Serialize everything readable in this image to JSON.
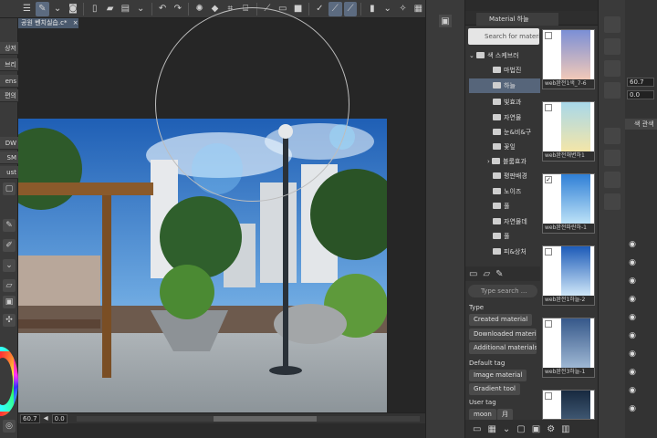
{
  "document": {
    "tab_title": "공원 벤치실습.c*",
    "close_glyph": "×"
  },
  "left_panel": {
    "labels": [
      "상저",
      "브리",
      "ens",
      "편의",
      "DW",
      "SM",
      "ust"
    ],
    "wheel_colors": [
      "#ff3333",
      "#ffff33",
      "#33ff33",
      "#33ffff",
      "#3333ff",
      "#ff33ff"
    ]
  },
  "status": {
    "zoom": "60.7",
    "angle": "0.0"
  },
  "material_panel": {
    "tab_label": "Material 하늘",
    "search_placeholder": "Search for materials",
    "tree": [
      {
        "label": "색 스케브러"
      },
      {
        "label": "마법진"
      },
      {
        "label": "하늘",
        "selected": true
      },
      {
        "label": "빛효과"
      },
      {
        "label": "자연물"
      },
      {
        "label": "눈&비&구"
      },
      {
        "label": "꽃잎"
      },
      {
        "label": "블룸효과"
      },
      {
        "label": "평판배경"
      },
      {
        "label": "노이즈"
      },
      {
        "label": "풀"
      },
      {
        "label": "자연물데"
      },
      {
        "label": "풀"
      },
      {
        "label": "피&상처"
      }
    ],
    "tag_search_placeholder": "Type search ...",
    "type_header": "Type",
    "type_chips": [
      "Created material",
      "Downloaded materi",
      "Additional materials"
    ],
    "default_tag_header": "Default tag",
    "default_tag_chips": [
      "Image material",
      "Gradient tool"
    ],
    "user_tag_header": "User tag",
    "user_tag_chips": [
      "moon",
      "月"
    ],
    "thumbnails": [
      {
        "caption": "web완전1색_7-6",
        "top_color": "#7b8fd6",
        "bottom_color": "#f2c9b8",
        "checked": false
      },
      {
        "caption": "web완전해변하1",
        "top_color": "#a8d8ea",
        "bottom_color": "#f4e6a8",
        "checked": false
      },
      {
        "caption": "web완전파란하-1",
        "top_color": "#2f7fd6",
        "bottom_color": "#bde2f7",
        "checked": true
      },
      {
        "caption": "web완전1하늘-2",
        "top_color": "#1d5bb8",
        "bottom_color": "#cfe7f8",
        "checked": false
      },
      {
        "caption": "web완전3하늘-1",
        "top_color": "#36588a",
        "bottom_color": "#9fb8d4",
        "checked": false
      },
      {
        "caption": "",
        "top_color": "#17293f",
        "bottom_color": "#5b7896",
        "checked": false
      }
    ]
  },
  "right_panel": {
    "zoom": "60.7",
    "angle": "0.0",
    "layer_label": "색 관색"
  }
}
